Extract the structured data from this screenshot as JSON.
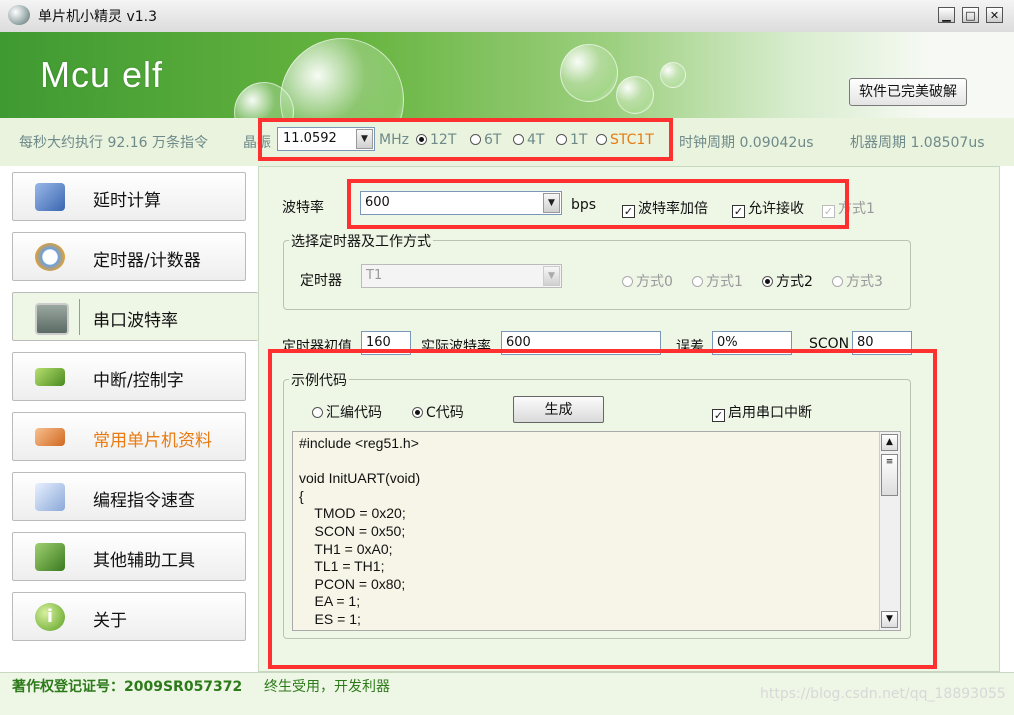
{
  "window": {
    "title": "单片机小精灵  v1.3"
  },
  "banner": {
    "logo": "Mcu elf",
    "crack_button": "软件已完美破解"
  },
  "infobar": {
    "speed": "每秒大约执行 92.16 万条指令",
    "crystal_label": "晶振",
    "crystal_value": "11.0592",
    "crystal_unit": "MHz",
    "modes": [
      "12T",
      "6T",
      "4T",
      "1T",
      "STC1T"
    ],
    "selected_mode": "12T",
    "clock_period": "时钟周期 0.09042us",
    "machine_period": "机器周期 1.08507us"
  },
  "sidebar": {
    "items": [
      {
        "label": "延时计算",
        "icon": "calculator-icon"
      },
      {
        "label": "定时器/计数器",
        "icon": "alarm-clock-icon"
      },
      {
        "label": "串口波特率",
        "icon": "monitor-icon"
      },
      {
        "label": "中断/控制字",
        "icon": "chip-icon"
      },
      {
        "label": "常用单片机资料",
        "icon": "book-icon"
      },
      {
        "label": "编程指令速查",
        "icon": "magnifier-icon"
      },
      {
        "label": "其他辅助工具",
        "icon": "tools-icon"
      },
      {
        "label": "关于",
        "icon": "info-icon"
      }
    ],
    "active_index": 2,
    "highlight_index": 4
  },
  "baud": {
    "label": "波特率",
    "value": "600",
    "unit": "bps",
    "double_label": "波特率加倍",
    "double_checked": true,
    "rx_label": "允许接收",
    "rx_checked": true,
    "mode_label": "方式1",
    "mode_checked": true
  },
  "timer_group": {
    "title": "选择定时器及工作方式",
    "timer_label": "定时器",
    "timer_value": "T1",
    "modes": [
      "方式0",
      "方式1",
      "方式2",
      "方式3"
    ],
    "selected_mode": "方式2"
  },
  "results": {
    "init_label": "定时器初值",
    "init_value": "160",
    "actual_label": "实际波特率",
    "actual_value": "600",
    "error_label": "误差",
    "error_value": "0%",
    "scon_label": "SCON",
    "scon_value": "80"
  },
  "code_group": {
    "title": "示例代码",
    "asm_label": "汇编代码",
    "c_label": "C代码",
    "selected": "C代码",
    "generate_button": "生成",
    "enable_int_label": "启用串口中断",
    "enable_int_checked": true,
    "code": "#include <reg51.h>\n\nvoid InitUART(void)\n{\n    TMOD = 0x20;\n    SCON = 0x50;\n    TH1 = 0xA0;\n    TL1 = TH1;\n    PCON = 0x80;\n    EA = 1;\n    ES = 1;"
  },
  "status": {
    "copyright": "著作权登记证号：2009SR057372",
    "motto": "终生受用，开发利器",
    "watermark": "https://blog.csdn.net/qq_18893055"
  },
  "colors": {
    "accent_green": "#3f9a32",
    "highlight_orange": "#e87b11",
    "annotation_red": "#ff3030"
  }
}
